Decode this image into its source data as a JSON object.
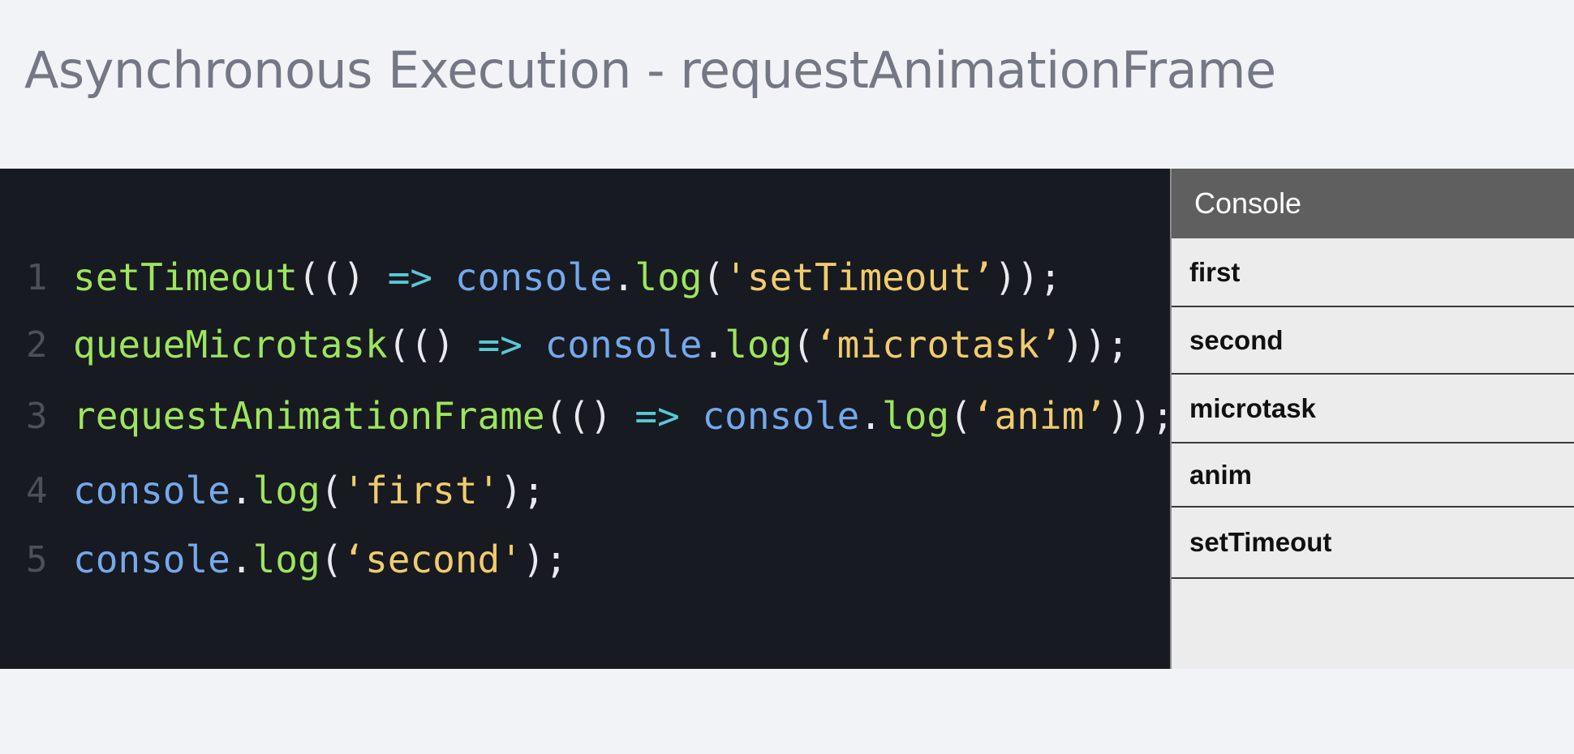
{
  "slide": {
    "title": "Asynchronous Execution - requestAnimationFrame"
  },
  "code": {
    "lines": [
      {
        "number": "1",
        "tokens": [
          {
            "text": "setTimeout",
            "kind": "fn"
          },
          {
            "text": "((",
            "kind": "punc"
          },
          {
            "text": ") ",
            "kind": "punc"
          },
          {
            "text": "=>",
            "kind": "arrow"
          },
          {
            "text": " ",
            "kind": "punc"
          },
          {
            "text": "console",
            "kind": "obj"
          },
          {
            "text": ".",
            "kind": "punc"
          },
          {
            "text": "log",
            "kind": "fn"
          },
          {
            "text": "(",
            "kind": "punc"
          },
          {
            "text": "'setTimeout’",
            "kind": "str"
          },
          {
            "text": "));",
            "kind": "punc"
          }
        ]
      },
      {
        "number": "2",
        "tokens": [
          {
            "text": "queueMicrotask",
            "kind": "fn"
          },
          {
            "text": "((",
            "kind": "punc"
          },
          {
            "text": ") ",
            "kind": "punc"
          },
          {
            "text": "=>",
            "kind": "arrow"
          },
          {
            "text": " ",
            "kind": "punc"
          },
          {
            "text": "console",
            "kind": "obj"
          },
          {
            "text": ".",
            "kind": "punc"
          },
          {
            "text": "log",
            "kind": "fn"
          },
          {
            "text": "(",
            "kind": "punc"
          },
          {
            "text": "‘microtask’",
            "kind": "str"
          },
          {
            "text": "));",
            "kind": "punc"
          }
        ]
      },
      {
        "number": "3",
        "tokens": [
          {
            "text": "requestAnimationFrame",
            "kind": "fn"
          },
          {
            "text": "((",
            "kind": "punc"
          },
          {
            "text": ") ",
            "kind": "punc"
          },
          {
            "text": "=>",
            "kind": "arrow"
          },
          {
            "text": " ",
            "kind": "punc"
          },
          {
            "text": "console",
            "kind": "obj"
          },
          {
            "text": ".",
            "kind": "punc"
          },
          {
            "text": "log",
            "kind": "fn"
          },
          {
            "text": "(",
            "kind": "punc"
          },
          {
            "text": "‘anim’",
            "kind": "str"
          },
          {
            "text": "));",
            "kind": "punc"
          }
        ]
      },
      {
        "number": "4",
        "tokens": [
          {
            "text": "console",
            "kind": "obj"
          },
          {
            "text": ".",
            "kind": "punc"
          },
          {
            "text": "log",
            "kind": "fn"
          },
          {
            "text": "(",
            "kind": "punc"
          },
          {
            "text": "'first'",
            "kind": "str"
          },
          {
            "text": ");",
            "kind": "punc"
          }
        ]
      },
      {
        "number": "5",
        "tokens": [
          {
            "text": "console",
            "kind": "obj"
          },
          {
            "text": ".",
            "kind": "punc"
          },
          {
            "text": "log",
            "kind": "fn"
          },
          {
            "text": "(",
            "kind": "punc"
          },
          {
            "text": "‘second'",
            "kind": "str"
          },
          {
            "text": ");",
            "kind": "punc"
          }
        ]
      }
    ]
  },
  "console": {
    "header": "Console",
    "entries": [
      "first",
      "second",
      "microtask",
      "anim",
      "setTimeout"
    ]
  },
  "colors": {
    "background": "#f2f3f6",
    "title": "#737884",
    "editor_bg": "#181a21",
    "function": "#9de55d",
    "object": "#74a9ec",
    "arrow": "#58c9d6",
    "string": "#f0cc6e",
    "punctuation": "#e9eaee",
    "console_header_bg": "#5f5f5f",
    "console_bg": "#ececec"
  }
}
